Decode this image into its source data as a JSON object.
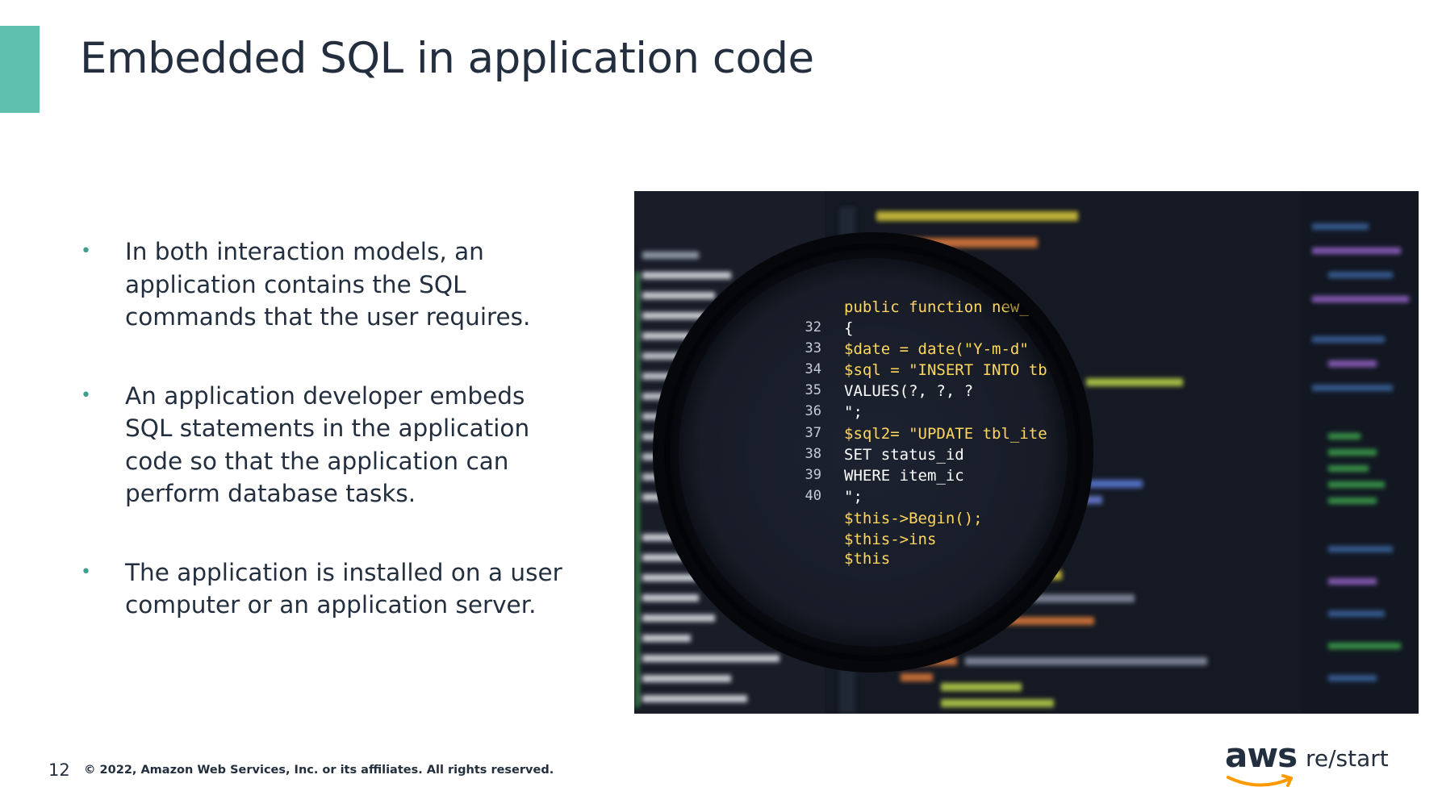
{
  "slide": {
    "title": "Embedded SQL in application code",
    "page_number": "12",
    "copyright": "© 2022, Amazon Web Services, Inc. or its affiliates. All rights reserved.",
    "accent_color": "#5fbfad"
  },
  "bullets": [
    "In both interaction models, an application contains the SQL commands that the user requires.",
    "An application developer embeds SQL statements in the application code so that the application can perform database tasks.",
    "The application is installed on a user computer or an application server."
  ],
  "code_image": {
    "line_numbers": [
      "32",
      "33",
      "34",
      "35",
      "36",
      "37",
      "38",
      "39",
      "40"
    ],
    "code_lines": [
      "public function new_re",
      "{",
      "    $date = date(\"Y-m-d\"",
      "    $sql = \"INSERT INTO tb",
      "           VALUES(?, ?, ?",
      "    \";",
      "    $sql2= \"UPDATE tbl_ite",
      "           SET status_id",
      "           WHERE item_ic",
      "    \";",
      "    $this->Begin();",
      "      $this->ins",
      "      $this"
    ]
  },
  "logo": {
    "brand": "aws",
    "product": "re/start"
  }
}
